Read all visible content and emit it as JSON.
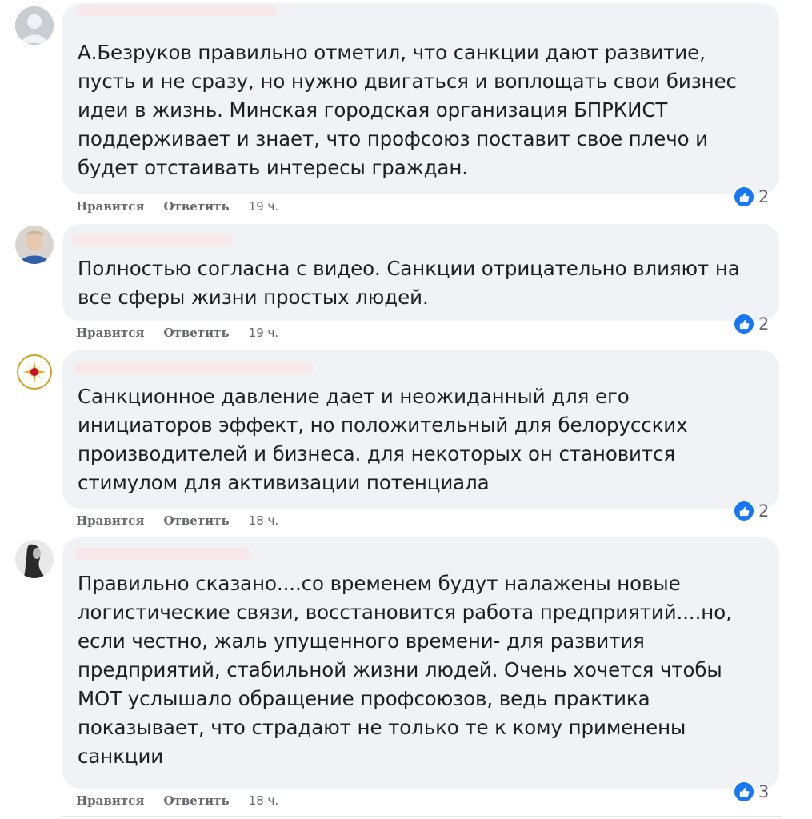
{
  "comments": [
    {
      "text": "А.Безруков правильно отметил, что санкции дают развитие,\nпусть и не сразу, но нужно двигаться и воплощать свои бизнес\nидеи в жизнь. Минская городская организация БПРКИСТ\nподдерживает и знает, что профсоюз поставит свое плечо и\nбудет отстаивать интересы граждан.",
      "like_label": "Нравится",
      "reply_label": "Ответить",
      "time": "19 ч.",
      "reactions": "2"
    },
    {
      "text": "Полностью согласна с видео. Санкции отрицательно влияют на\nвсе сферы жизни простых людей.",
      "like_label": "Нравится",
      "reply_label": "Ответить",
      "time": "19 ч.",
      "reactions": "2"
    },
    {
      "text": "Санкционное давление дает и неожиданный для его\nинициаторов эффект, но положительный для белорусских\nпроизводителей и бизнеса. для некоторых он становится\nстимулом для активизации потенциала",
      "like_label": "Нравится",
      "reply_label": "Ответить",
      "time": "18 ч.",
      "reactions": "2"
    },
    {
      "text": "Правильно сказано....со временем будут налажены новые\nлогистические связи, восстановится работа предприятий....но,\nесли честно, жаль упущенного времени- для развития\nпредприятий, стабильной жизни людей. Очень хочется чтобы\nМОТ услышало обращение профсоюзов, ведь практика\nпоказывает, что страдают не только те к кому применены\nсанкции",
      "like_label": "Нравится",
      "reply_label": "Ответить",
      "time": "18 ч.",
      "reactions": "3"
    }
  ]
}
